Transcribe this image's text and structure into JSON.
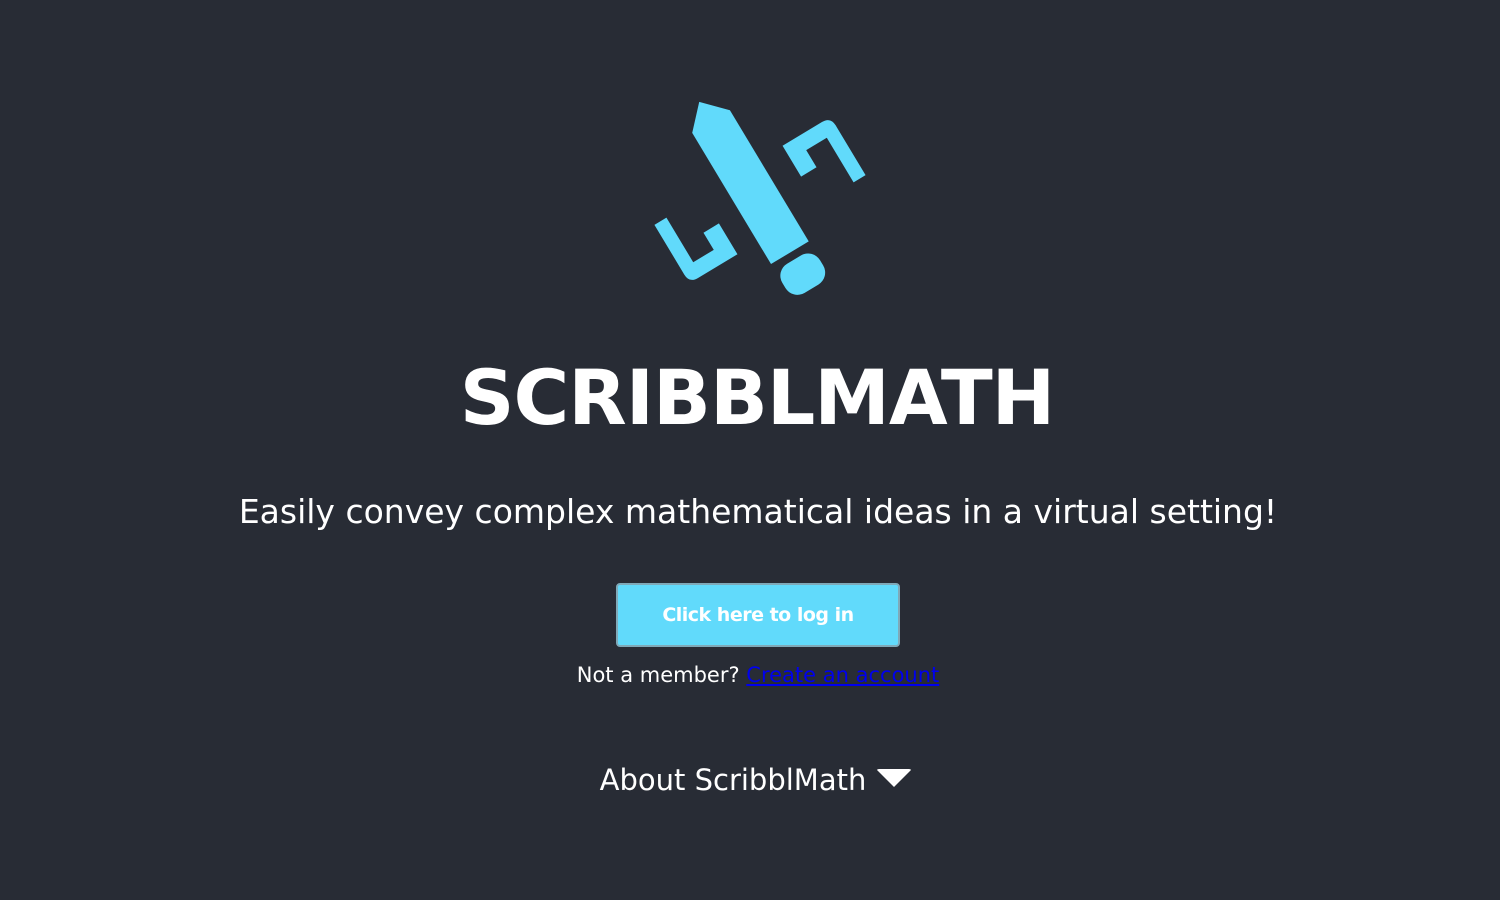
{
  "app": {
    "brand_name": "SCRIBBLMATH",
    "tagline": "Easily convey complex mathematical ideas in a virtual setting!",
    "accent_color": "#61dafb",
    "background_color": "#282c35"
  },
  "logo": {
    "icon": "pencil-logo-icon"
  },
  "auth": {
    "login_label": "Click here to log in",
    "not_member_text": "Not a member?",
    "create_account_label": "Create an account"
  },
  "about": {
    "label": "About ScribblMath",
    "toggle_icon": "chevron-down-icon"
  }
}
